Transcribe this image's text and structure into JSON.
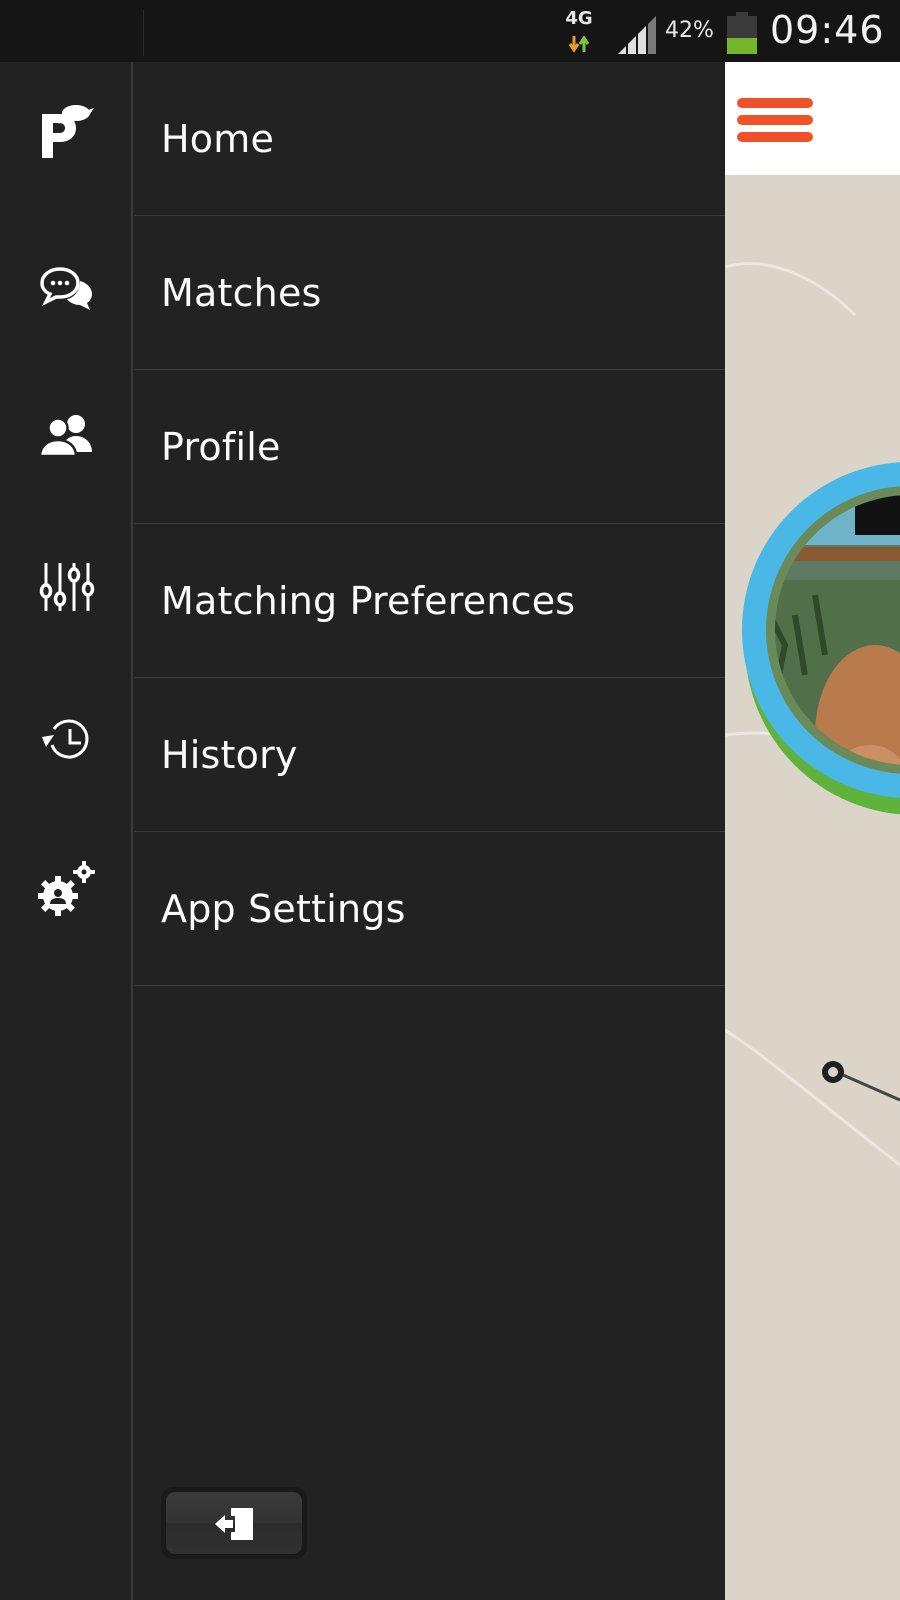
{
  "status_bar": {
    "network": "4G",
    "battery_percent": "42%",
    "battery_level": 0.42,
    "time": "09:46"
  },
  "menu": {
    "items": [
      {
        "label": "Home",
        "icon": "home-logo-icon"
      },
      {
        "label": "Matches",
        "icon": "chat-bubbles-icon"
      },
      {
        "label": "Profile",
        "icon": "users-icon"
      },
      {
        "label": "Matching Preferences",
        "icon": "sliders-icon"
      },
      {
        "label": "History",
        "icon": "history-clock-icon"
      },
      {
        "label": "App Settings",
        "icon": "gears-icon"
      }
    ],
    "logout_icon": "logout-door-icon"
  },
  "content": {
    "menu_icon": "hamburger-menu-icon",
    "accent": "#ef5128",
    "ring_color": "#4ab8e6"
  }
}
